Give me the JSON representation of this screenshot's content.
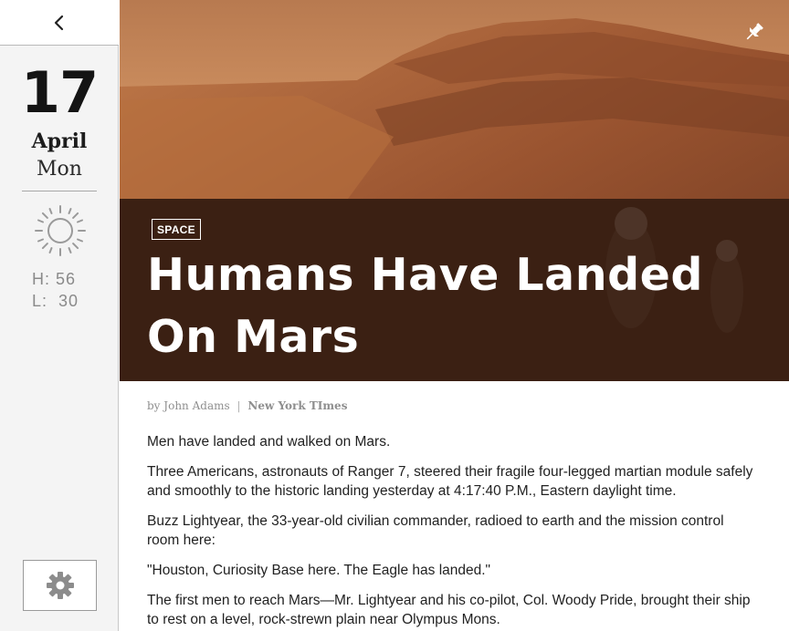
{
  "sidebar": {
    "back_icon": "chevron-left-icon",
    "date": {
      "day": "17",
      "month": "April",
      "weekday": "Mon"
    },
    "weather": {
      "icon": "sun-icon",
      "high_label": "H:",
      "high_value": "56",
      "low_label": "L:",
      "low_value": "30"
    },
    "settings_icon": "gear-icon"
  },
  "hero": {
    "pin_icon": "pin-icon",
    "category": "SPACE",
    "headline": "Humans Have Landed On Mars"
  },
  "article": {
    "byline_prefix": "by",
    "author": "John Adams",
    "separator": "|",
    "source": "New York TImes",
    "paragraphs": [
      "Men have landed and walked on Mars.",
      "Three Americans, astronauts of Ranger 7, steered their fragile four-legged martian module safely and smoothly to the historic landing yesterday at 4:17:40 P.M., Eastern daylight time.",
      "Buzz Lightyear, the 33-year-old civilian commander, radioed to earth and the mission control room here:",
      "\"Houston, Curiosity Base here. The Eagle has landed.\"",
      "The first men to reach Mars—Mr. Lightyear and his co-pilot, Col. Woody Pride, brought their ship to rest on a level, rock-strewn plain near Olympus Mons."
    ]
  },
  "colors": {
    "sidebar_bg": "#f4f4f4",
    "text_dark": "#222222",
    "byline_gray": "#8f8f8f",
    "mars_orange": "#a45a2e"
  }
}
